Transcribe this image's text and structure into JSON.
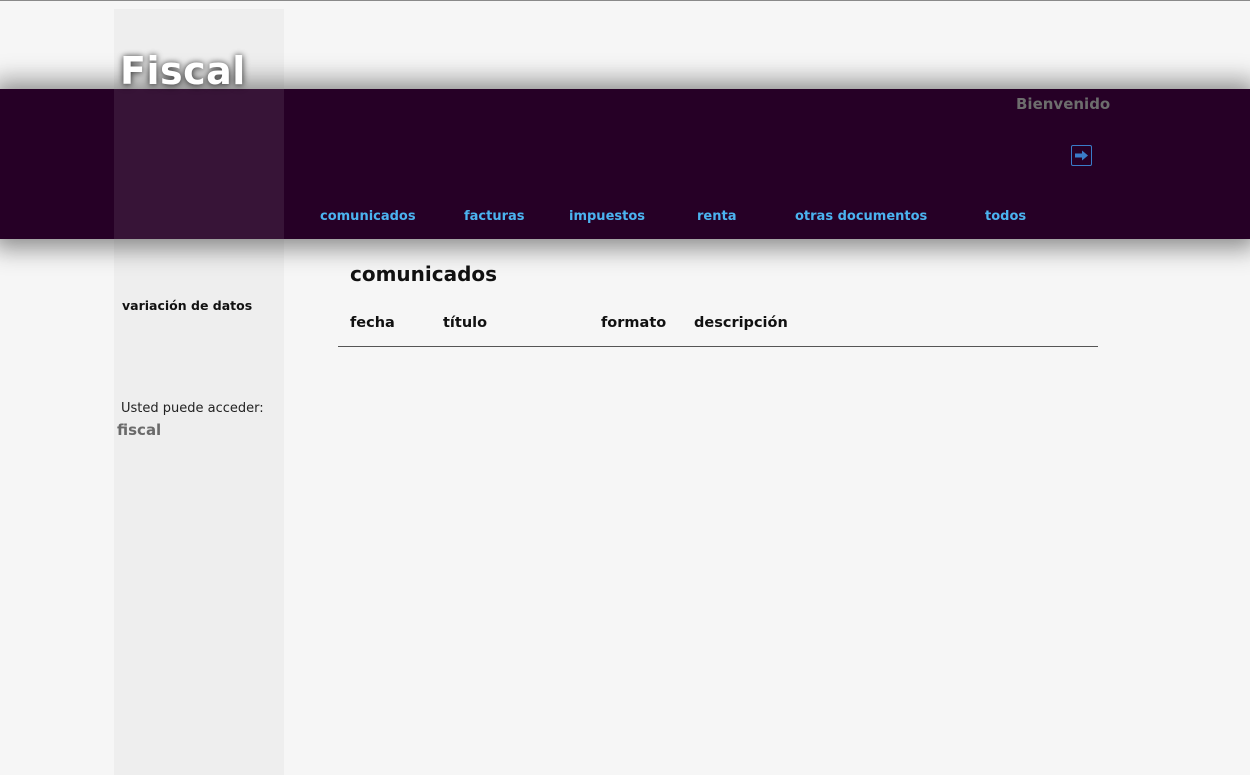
{
  "site": {
    "title": "Fiscal"
  },
  "header": {
    "welcome": "Bienvenido",
    "logout_icon": "logout-arrow-icon"
  },
  "nav": {
    "items": [
      {
        "label": "comunicados"
      },
      {
        "label": "facturas"
      },
      {
        "label": "impuestos"
      },
      {
        "label": "renta"
      },
      {
        "label": "otras documentos"
      },
      {
        "label": "todos"
      }
    ]
  },
  "sidebar": {
    "link": "variación de datos",
    "access_label": "Usted puede acceder:",
    "access_value": "fiscal"
  },
  "main": {
    "section_title": "comunicados",
    "table": {
      "columns": [
        "fecha",
        "título",
        "formato",
        "descripción"
      ],
      "rows": []
    }
  },
  "colors": {
    "header_bg": "#260026",
    "nav_link": "#4bb3f0",
    "page_bg": "#f6f6f6",
    "sidebar_bg": "#eeeeee"
  }
}
